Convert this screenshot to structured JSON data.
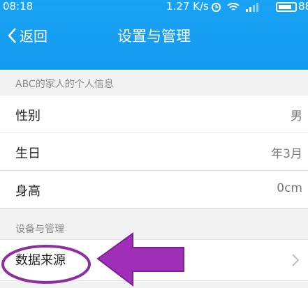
{
  "status": {
    "time": "08:18",
    "speed": "1.27 K/s",
    "battery": "88"
  },
  "nav": {
    "back_label": "返回",
    "title": "设置与管理"
  },
  "section1": {
    "header": "ABC的家人的个人信息",
    "rows": [
      {
        "label": "性别",
        "value": "男"
      },
      {
        "label": "生日",
        "value": "年3月"
      },
      {
        "label": "身高",
        "value": "0cm"
      }
    ]
  },
  "section2": {
    "header": "设备与管理",
    "rows": [
      {
        "label": "数据来源"
      }
    ]
  },
  "annotation": {
    "color": "#8e2fa0"
  }
}
